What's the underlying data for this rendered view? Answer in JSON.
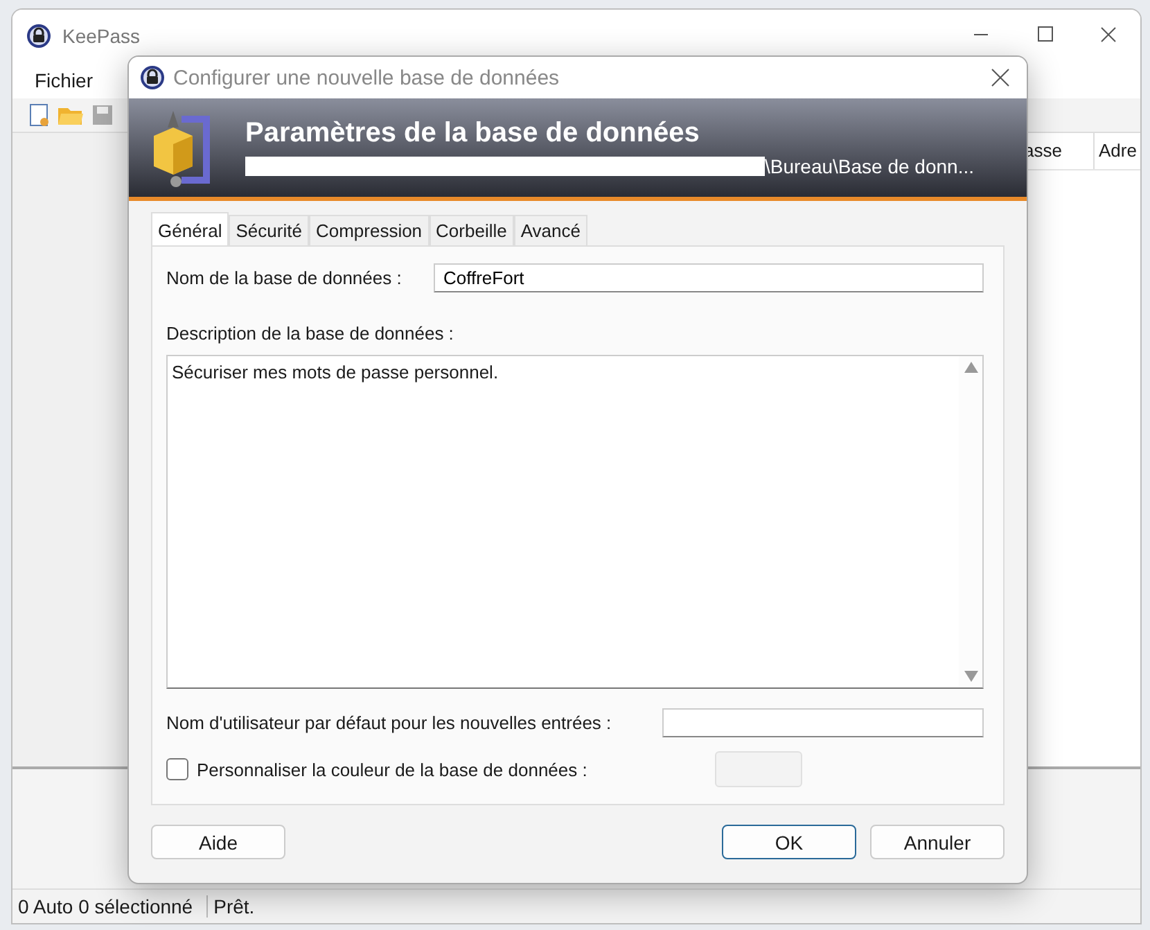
{
  "main_window": {
    "title": "KeePass",
    "menu": [
      "Fichier"
    ],
    "columns": [
      "asse",
      "Adre"
    ],
    "status_bar": [
      "0 Auto 0 sélectionné",
      "Prêt."
    ]
  },
  "dialog": {
    "title": "Configurer une nouvelle base de données",
    "banner": {
      "title": "Paramètres de la base de données",
      "path": "\\Bureau\\Base de donn..."
    },
    "tabs": [
      {
        "label": "Général",
        "selected": true
      },
      {
        "label": "Sécurité",
        "selected": false
      },
      {
        "label": "Compression",
        "selected": false
      },
      {
        "label": "Corbeille",
        "selected": false
      },
      {
        "label": "Avancé",
        "selected": false
      }
    ],
    "name_label": "Nom de la base de données :",
    "name_value": "CoffreFort",
    "description_label": "Description de la base de données :",
    "description_value": "Sécuriser mes mots de passe personnel.",
    "username_label": "Nom d'utilisateur par défaut pour les nouvelles entrées :",
    "custom_color": {
      "label": "Personnaliser la couleur de la base de données :",
      "checked": false
    },
    "buttons": [
      {
        "label": "Aide",
        "kind": "help"
      },
      {
        "label": "OK",
        "kind": "default"
      },
      {
        "label": "Annuler",
        "kind": "cancel"
      }
    ]
  }
}
